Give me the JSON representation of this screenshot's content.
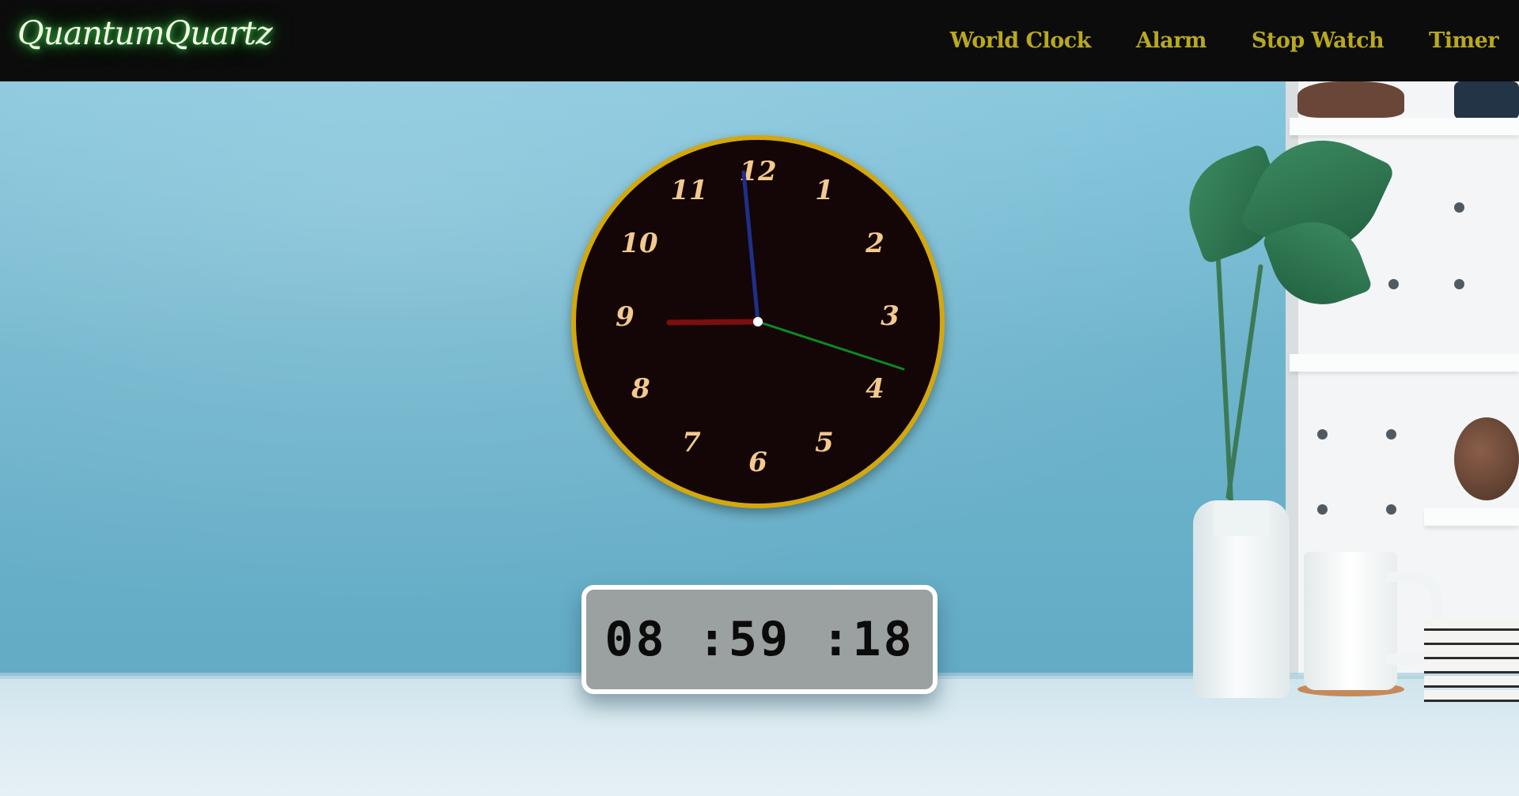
{
  "brand": {
    "logo_text": "QuantumQuartz"
  },
  "nav": {
    "items": [
      {
        "label": "World Clock"
      },
      {
        "label": "Alarm"
      },
      {
        "label": "Stop Watch"
      },
      {
        "label": "Timer"
      }
    ]
  },
  "clock": {
    "numerals": [
      "12",
      "1",
      "2",
      "3",
      "4",
      "5",
      "6",
      "7",
      "8",
      "9",
      "10",
      "11"
    ],
    "hour_hand_color": "#7a0f0f",
    "minute_hand_color": "#1f2f8a",
    "second_hand_color": "#0d8a1e",
    "face_color": "#140606",
    "rim_color": "#d3a80c",
    "numeral_color": "#f3c98e"
  },
  "digital": {
    "time_text": "08 :59 :18"
  },
  "colors": {
    "nav_text": "#b8a91e",
    "nav_bg": "#0c0c0c",
    "logo_glow": "#3dc24a"
  }
}
